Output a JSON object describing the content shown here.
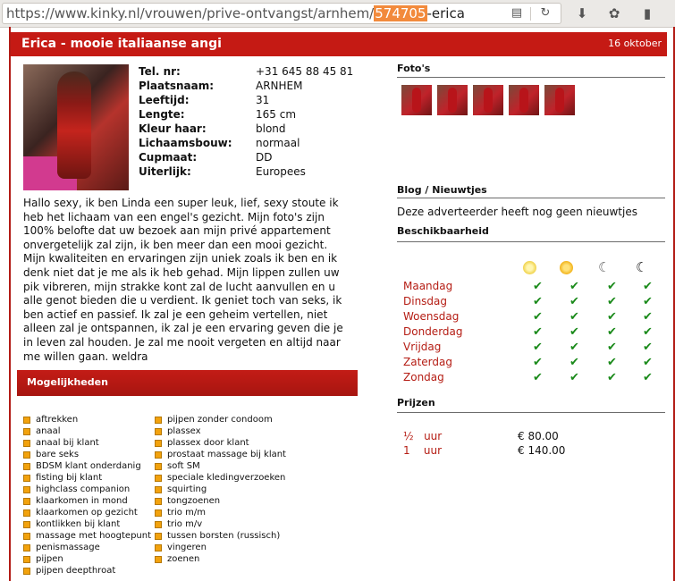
{
  "browser": {
    "url_prefix": "https://www.kinky.nl/vrouwen/prive-ontvangst/arnhem/",
    "url_highlight": "574705",
    "url_suffix": "-erica",
    "reader_icon": "reader-icon",
    "reload_icon": "reload-icon",
    "download_icon": "download-icon",
    "extension_icon": "extension-icon",
    "clipboard_icon": "clipboard-icon"
  },
  "listing": {
    "title": "Erica - mooie italiaanse angi",
    "date": "16 oktober"
  },
  "specs": [
    {
      "label": "Tel. nr:",
      "value": "+31 645 88 45 81"
    },
    {
      "label": "Plaatsnaam:",
      "value": "ARNHEM"
    },
    {
      "label": "Leeftijd:",
      "value": "31"
    },
    {
      "label": "Lengte:",
      "value": "165 cm"
    },
    {
      "label": "Kleur haar:",
      "value": "blond"
    },
    {
      "label": "Lichaamsbouw:",
      "value": "normaal"
    },
    {
      "label": "Cupmaat:",
      "value": "DD"
    },
    {
      "label": "Uiterlijk:",
      "value": "Europees"
    }
  ],
  "description": "Hallo sexy, ik ben Linda een super leuk, lief, sexy stoute ik heb het lichaam van een engel's gezicht. Mijn foto's zijn 100% belofte dat uw bezoek aan mijn privé appartement onvergetelijk zal zijn, ik ben meer dan een mooi gezicht. Mijn kwaliteiten en ervaringen zijn uniek zoals ik ben en ik denk niet dat je me als ik heb gehad. Mijn lippen zullen uw pik vibreren, mijn strakke kont zal de lucht aanvullen en u alle genot bieden die u verdient. Ik geniet toch van seks, ik ben actief en passief. Ik zal je een geheim vertellen, niet alleen zal je ontspannen, ik zal je een ervaring geven die je in leven zal houden. Je zal me nooit vergeten en altijd naar me willen gaan. weldra",
  "mogelijkheden": {
    "title": "Mogelijkheden",
    "col1": [
      "aftrekken",
      "anaal",
      "anaal bij klant",
      "bare seks",
      "BDSM klant onderdanig",
      "fisting bij klant",
      "highclass companion",
      "klaarkomen in mond",
      "klaarkomen op gezicht",
      "kontlikken bij klant",
      "massage met hoogtepunt",
      "penismassage",
      "pijpen",
      "pijpen deepthroat"
    ],
    "col2": [
      "pijpen zonder condoom",
      "plassex",
      "plassex door klant",
      "prostaat massage bij klant",
      "soft SM",
      "speciale kledingverzoeken",
      "squirting",
      "tongzoenen",
      "trio m/m",
      "trio m/v",
      "tussen borsten (russisch)",
      "vingeren",
      "zoenen"
    ]
  },
  "photos": {
    "title": "Foto's",
    "count": 5
  },
  "blog": {
    "title": "Blog / Nieuwtjes",
    "text": "Deze adverteerder heeft nog geen nieuwtjes"
  },
  "availability": {
    "title": "Beschikbaarheid",
    "slot_icons": [
      "morning-sun-icon",
      "afternoon-sun-icon",
      "evening-moon-icon",
      "night-moon-icon"
    ],
    "days": [
      "Maandag",
      "Dinsdag",
      "Woensdag",
      "Donderdag",
      "Vrijdag",
      "Zaterdag",
      "Zondag"
    ],
    "check_symbol": "✔"
  },
  "prices": {
    "title": "Prijzen",
    "rows": [
      {
        "duration": "½   uur",
        "price": "€ 80.00"
      },
      {
        "duration": "1    uur",
        "price": "€ 140.00"
      }
    ]
  }
}
